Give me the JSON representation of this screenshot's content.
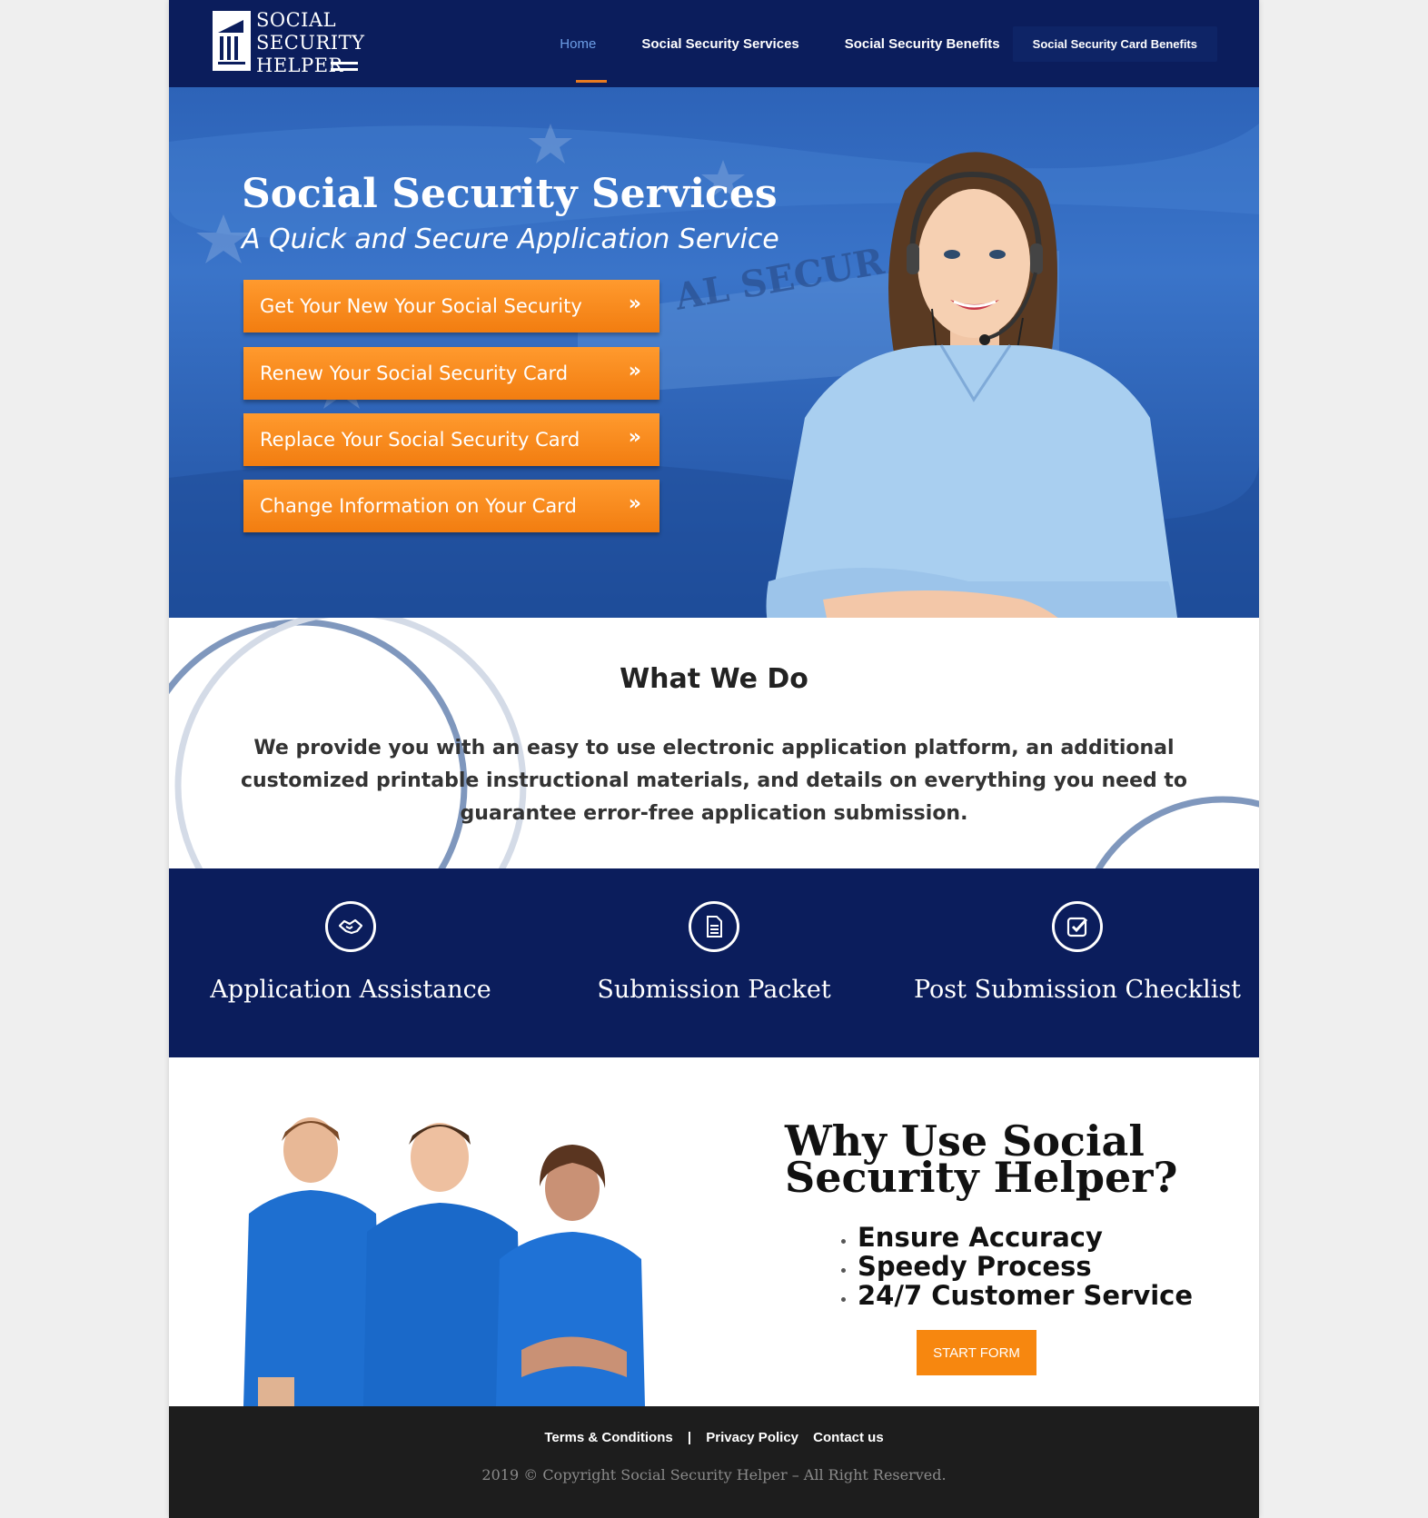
{
  "header": {
    "logo": [
      "SOCIAL",
      "SECURITY",
      "HELPER"
    ],
    "nav": [
      "Home",
      "Social Security Services",
      "Social Security Benefits",
      "Social Security Card Benefits"
    ]
  },
  "hero": {
    "title": "Social Security Services",
    "subtitle": "A Quick and Secure Application Service",
    "buttons": [
      "Get Your New Your Social Security",
      "Renew Your Social Security Card",
      "Replace Your Social Security Card",
      "Change Information on Your Card"
    ],
    "chevron": "»"
  },
  "what": {
    "title": "What We Do",
    "text": "We provide you with an easy to use electronic application platform, an additional customized printable instructional materials, and details on everything you need to guarantee error-free application submission."
  },
  "features": [
    {
      "label": "Application Assistance",
      "icon": "handshake-icon"
    },
    {
      "label": "Submission Packet",
      "icon": "document-icon"
    },
    {
      "label": "Post Submission Checklist",
      "icon": "checkbox-icon"
    }
  ],
  "why": {
    "title_line1": "Why Use Social",
    "title_line2": "Security Helper?",
    "items": [
      "Ensure Accuracy",
      "Speedy Process",
      "24/7 Customer Service"
    ],
    "cta": "START FORM"
  },
  "footer": {
    "links": [
      "Terms & Conditions",
      "Privacy Policy",
      "Contact us"
    ],
    "copyright": "2019 © Copyright Social Security Helper – All Right Reserved."
  },
  "colors": {
    "navy": "#0b1d5c",
    "orange": "#f7870f",
    "hero_blue": "#2d63b8"
  }
}
